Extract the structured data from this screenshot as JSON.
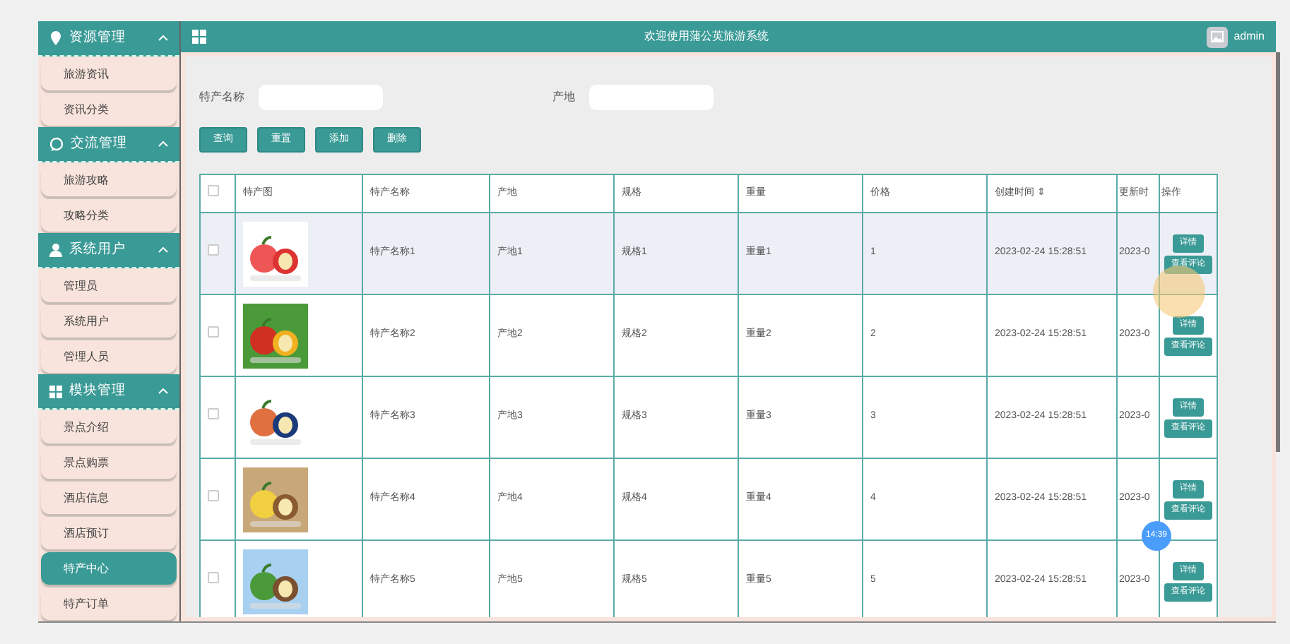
{
  "sidebar": {
    "groups": [
      {
        "title": "资源管理",
        "expanded": true,
        "items": [
          {
            "label": "旅游资讯",
            "selected": false
          },
          {
            "label": "资讯分类",
            "selected": false
          }
        ]
      },
      {
        "title": "交流管理",
        "expanded": true,
        "items": [
          {
            "label": "旅游攻略",
            "selected": false
          },
          {
            "label": "攻略分类",
            "selected": false
          }
        ]
      },
      {
        "title": "系统用户",
        "expanded": true,
        "items": [
          {
            "label": "管理员",
            "selected": false
          },
          {
            "label": "系统用户",
            "selected": false
          },
          {
            "label": "管理人员",
            "selected": false
          }
        ]
      },
      {
        "title": "模块管理",
        "expanded": true,
        "items": [
          {
            "label": "景点介绍",
            "selected": false
          },
          {
            "label": "景点购票",
            "selected": false
          },
          {
            "label": "酒店信息",
            "selected": false
          },
          {
            "label": "酒店预订",
            "selected": false
          },
          {
            "label": "特产中心",
            "selected": true
          },
          {
            "label": "特产订单",
            "selected": false
          }
        ]
      }
    ]
  },
  "header": {
    "title": "欢迎使用蒲公英旅游系统",
    "user": "admin"
  },
  "search": {
    "fields": [
      {
        "label": "特产名称"
      },
      {
        "label": "产地"
      }
    ],
    "buttons": [
      "查询",
      "重置",
      "添加",
      "删除"
    ]
  },
  "table": {
    "columns": [
      "特产图",
      "特产名称",
      "产地",
      "规格",
      "重量",
      "价格",
      "创建时间",
      "更新时",
      "操作"
    ],
    "sort_icon": "⇕",
    "select_all_checked": false,
    "rows": [
      {
        "checked": false,
        "highlighted": true,
        "image": {
          "kind": "picture"
        },
        "name": "特产名称1",
        "origin": "产地1",
        "spec": "规格1",
        "weight": "重量1",
        "price": "1",
        "created": "2023-02-24 15:28:51",
        "updated": "2023-0",
        "actions": [
          "详情",
          "查看评论"
        ]
      },
      {
        "checked": false,
        "highlighted": false,
        "image": {
          "kind": "picture"
        },
        "name": "特产名称2",
        "origin": "产地2",
        "spec": "规格2",
        "weight": "重量2",
        "price": "2",
        "created": "2023-02-24 15:28:51",
        "updated": "2023-0",
        "actions": [
          "详情",
          "查看评论"
        ]
      },
      {
        "checked": false,
        "highlighted": false,
        "image": {
          "kind": "picture"
        },
        "name": "特产名称3",
        "origin": "产地3",
        "spec": "规格3",
        "weight": "重量3",
        "price": "3",
        "created": "2023-02-24 15:28:51",
        "updated": "2023-0",
        "actions": [
          "详情",
          "查看评论"
        ]
      },
      {
        "checked": false,
        "highlighted": false,
        "image": {
          "kind": "picture"
        },
        "name": "特产名称4",
        "origin": "产地4",
        "spec": "规格4",
        "weight": "重量4",
        "price": "4",
        "created": "2023-02-24 15:28:51",
        "updated": "2023-0",
        "actions": [
          "详情",
          "查看评论"
        ]
      },
      {
        "checked": false,
        "highlighted": false,
        "image": {
          "kind": "picture"
        },
        "name": "特产名称5",
        "origin": "产地5",
        "spec": "规格5",
        "weight": "重量5",
        "price": "5",
        "created": "2023-02-24 15:28:51",
        "updated": "2023-0",
        "actions": [
          "详情",
          "查看评论"
        ]
      }
    ]
  },
  "clock_badge": "14:39"
}
